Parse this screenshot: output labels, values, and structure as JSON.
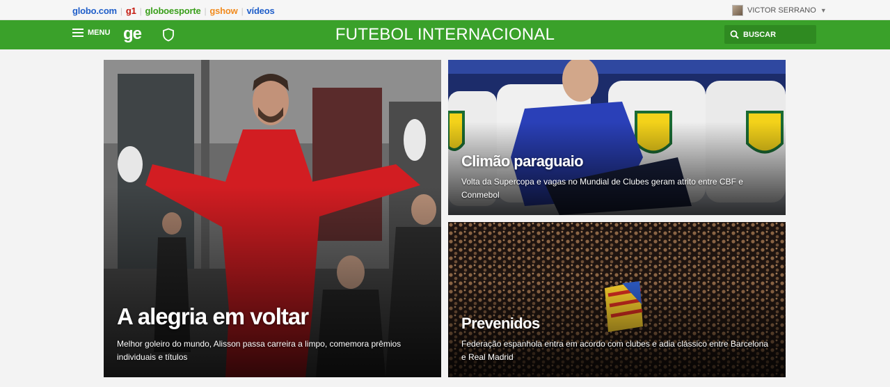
{
  "globo_bar": {
    "links": [
      "globo.com",
      "g1",
      "globoesporte",
      "gshow",
      "vídeos"
    ],
    "user_name": "VICTOR SERRANO"
  },
  "header": {
    "menu_label": "MENU",
    "logo": "ge",
    "title": "FUTEBOL INTERNACIONAL",
    "search_label": "BUSCAR",
    "brand_color": "#3aa12a"
  },
  "cards": [
    {
      "title": "A alegria em voltar",
      "subtitle": "Melhor goleiro do mundo, Alisson passa carreira a limpo, comemora prêmios individuais e títulos"
    },
    {
      "title": "Climão paraguaio",
      "subtitle": "Volta da Supercopa e vagas no Mundial de Clubes geram atrito entre CBF e Conmebol"
    },
    {
      "title": "Prevenidos",
      "subtitle": "Federação espanhola entra em acordo com clubes e adia clássico entre Barcelona e Real Madrid"
    }
  ]
}
